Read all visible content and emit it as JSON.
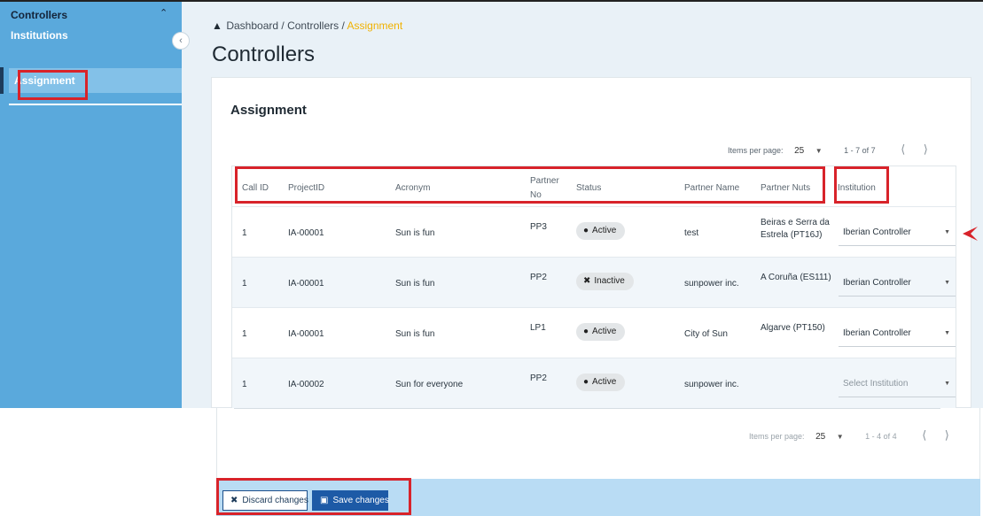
{
  "sidebar": {
    "section_label": "Controllers",
    "items": [
      {
        "label": "Institutions"
      },
      {
        "label": "Assignment"
      }
    ]
  },
  "breadcrumb": {
    "home": "Dashboard",
    "sep": "/",
    "middle": "Controllers",
    "current": "Assignment"
  },
  "page": {
    "title": "Controllers",
    "card_title": "Assignment"
  },
  "pager_top": {
    "items_label": "Items per page:",
    "per_page": "25",
    "range": "1 - 7 of 7"
  },
  "pager_bottom": {
    "items_label": "Items per page:",
    "per_page": "25",
    "range": "1 - 4 of 4"
  },
  "table": {
    "headers": {
      "call_id": "Call ID",
      "project_id": "ProjectID",
      "acronym": "Acronym",
      "partner_no_1": "Partner",
      "partner_no_2": "No",
      "status": "Status",
      "partner_name": "Partner Name",
      "partner_nuts": "Partner Nuts",
      "institution": "Institution"
    },
    "rows": [
      {
        "call_id": "1",
        "project_id": "IA-00001",
        "acronym": "Sun is fun",
        "partner_no": "PP3",
        "status": "Active",
        "partner_name": "test",
        "nuts_1": "Beiras e Serra da",
        "nuts_2": "Estrela (PT16J)",
        "institution": "Iberian Controller"
      },
      {
        "call_id": "1",
        "project_id": "IA-00001",
        "acronym": "Sun is fun",
        "partner_no": "PP2",
        "status": "Inactive",
        "partner_name": "sunpower inc.",
        "nuts_1": "A Coruña (ES111)",
        "nuts_2": "",
        "institution": "Iberian Controller"
      },
      {
        "call_id": "1",
        "project_id": "IA-00001",
        "acronym": "Sun is fun",
        "partner_no": "LP1",
        "status": "Active",
        "partner_name": "City of Sun",
        "nuts_1": "Algarve (PT150)",
        "nuts_2": "",
        "institution": "Iberian Controller"
      },
      {
        "call_id": "1",
        "project_id": "IA-00002",
        "acronym": "Sun for everyone",
        "partner_no": "PP2",
        "status": "Active",
        "partner_name": "sunpower inc.",
        "nuts_1": "",
        "nuts_2": "",
        "institution": "Select Institution"
      }
    ]
  },
  "footer": {
    "discard_label": "Discard changes",
    "save_label": "Save changes"
  },
  "colors": {
    "sidebar": "#5aa9dc",
    "highlight": "#d8232a",
    "primary": "#1d5aa6",
    "breadcrumb_current": "#f0b100"
  }
}
